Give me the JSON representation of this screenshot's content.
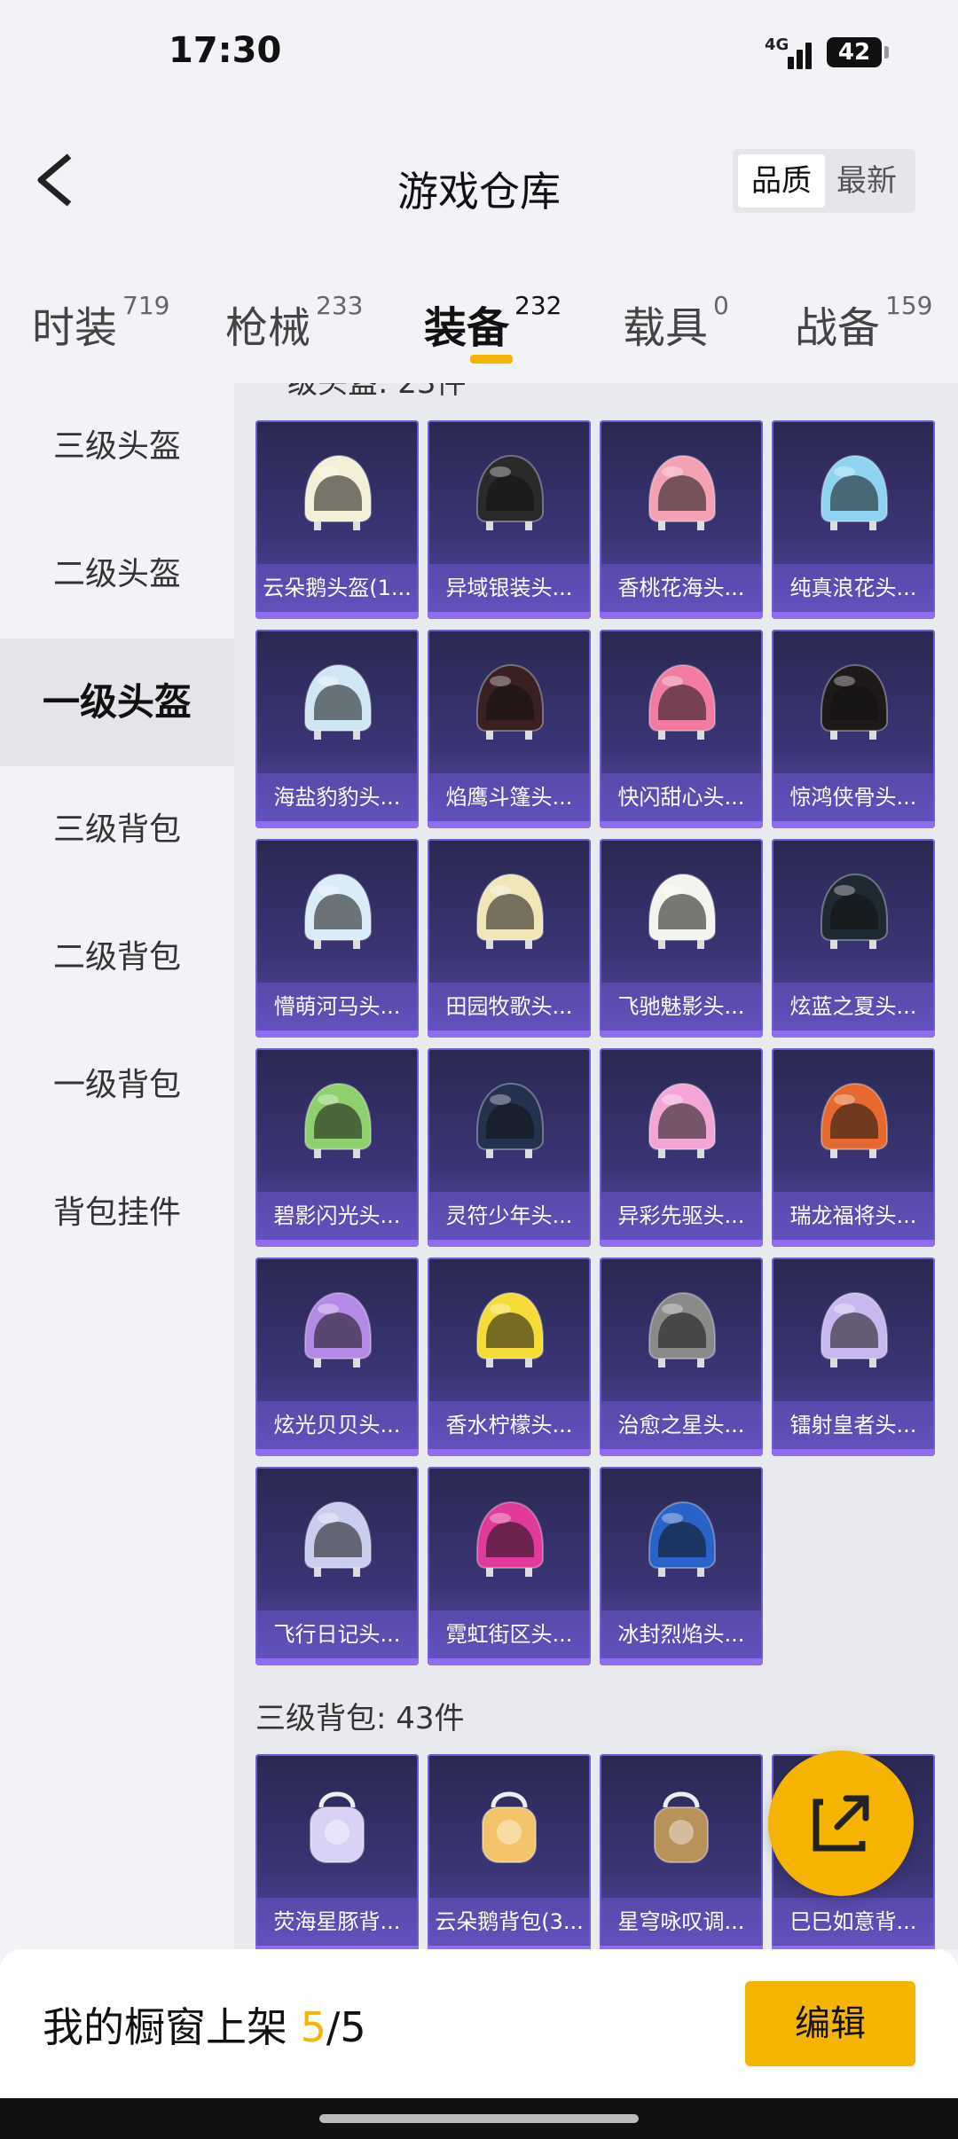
{
  "status": {
    "time": "17:30",
    "network": "4G",
    "battery": "42"
  },
  "header": {
    "title": "游戏仓库",
    "sort_options": [
      "品质",
      "最新"
    ],
    "sort_selected": "品质"
  },
  "tabs": [
    {
      "label": "时装",
      "count": "719"
    },
    {
      "label": "枪械",
      "count": "233"
    },
    {
      "label": "装备",
      "count": "232"
    },
    {
      "label": "载具",
      "count": "0"
    },
    {
      "label": "战备",
      "count": "159"
    }
  ],
  "sidebar": {
    "items": [
      "三级头盔",
      "二级头盔",
      "一级头盔",
      "三级背包",
      "二级背包",
      "一级背包",
      "背包挂件"
    ],
    "active": "一级头盔"
  },
  "content": {
    "cut_section_label": "级头盔: 23件",
    "helmets": [
      {
        "name": "云朵鹅头盔(1...",
        "icon": "helmet-icon",
        "color": "#f4f0d8"
      },
      {
        "name": "异域银装头...",
        "icon": "helmet-icon",
        "color": "#2a2a2a"
      },
      {
        "name": "香桃花海头...",
        "icon": "helmet-icon",
        "color": "#f3a2b4"
      },
      {
        "name": "纯真浪花头...",
        "icon": "helmet-icon",
        "color": "#8fd3f0"
      },
      {
        "name": "海盐豹豹头...",
        "icon": "helmet-icon",
        "color": "#cfe7f5"
      },
      {
        "name": "焰鹰斗篷头...",
        "icon": "helmet-icon",
        "color": "#3a2020"
      },
      {
        "name": "快闪甜心头...",
        "icon": "helmet-icon",
        "color": "#f27ca1"
      },
      {
        "name": "惊鸿侠骨头...",
        "icon": "helmet-icon",
        "color": "#1e1a1a"
      },
      {
        "name": "懵萌河马头...",
        "icon": "helmet-icon",
        "color": "#d9ecf8"
      },
      {
        "name": "田园牧歌头...",
        "icon": "helmet-icon",
        "color": "#f0e6b8"
      },
      {
        "name": "飞驰魅影头...",
        "icon": "helmet-icon",
        "color": "#f5f3ee"
      },
      {
        "name": "炫蓝之夏头...",
        "icon": "helmet-icon",
        "color": "#1e2a33"
      },
      {
        "name": "碧影闪光头...",
        "icon": "helmet-icon",
        "color": "#8fd06e"
      },
      {
        "name": "灵符少年头...",
        "icon": "helmet-icon",
        "color": "#24324f"
      },
      {
        "name": "异彩先驱头...",
        "icon": "helmet-icon",
        "color": "#f2a6d6"
      },
      {
        "name": "瑞龙福将头...",
        "icon": "helmet-icon",
        "color": "#e66a30"
      },
      {
        "name": "炫光贝贝头...",
        "icon": "helmet-icon",
        "color": "#b48ae6"
      },
      {
        "name": "香水柠檬头...",
        "icon": "helmet-icon",
        "color": "#f5dc3a"
      },
      {
        "name": "治愈之星头...",
        "icon": "helmet-icon",
        "color": "#8a8a8a"
      },
      {
        "name": "镭射皇者头...",
        "icon": "helmet-icon",
        "color": "#c9b8ef"
      },
      {
        "name": "飞行日记头...",
        "icon": "helmet-icon",
        "color": "#c9cdee"
      },
      {
        "name": "霓虹街区头...",
        "icon": "helmet-icon",
        "color": "#e03a9a"
      },
      {
        "name": "冰封烈焰头...",
        "icon": "helmet-icon",
        "color": "#2a63c8"
      }
    ],
    "backpack_section": {
      "title": "三级背包: 43件",
      "items": [
        {
          "name": "荧海星豚背...",
          "icon": "backpack-icon",
          "color": "#d9d2f5"
        },
        {
          "name": "云朵鹅背包(3...",
          "icon": "backpack-icon",
          "color": "#f3c46a"
        },
        {
          "name": "星穹咏叹调...",
          "icon": "backpack-icon",
          "color": "#b8925a"
        },
        {
          "name": "巳巳如意背...",
          "icon": "backpack-icon",
          "color": "#d0a050"
        }
      ]
    }
  },
  "fab": {
    "icon": "share-icon"
  },
  "bottom_bar": {
    "label": "我的橱窗上架",
    "current": "5",
    "separator": "/",
    "total": "5",
    "edit_label": "编辑"
  }
}
